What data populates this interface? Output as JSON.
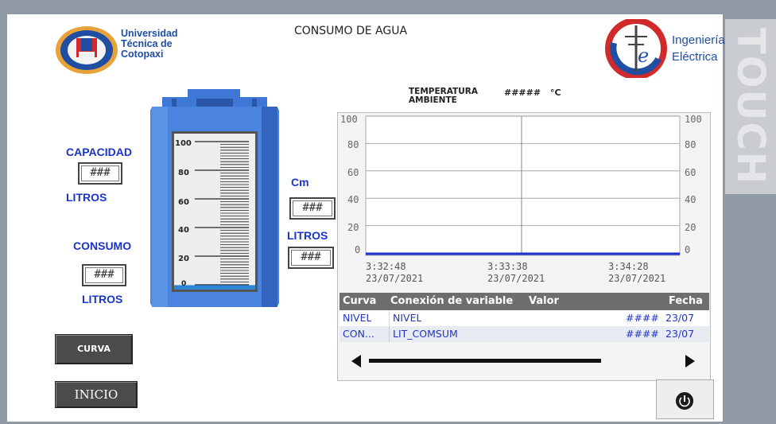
{
  "screen": {
    "title": "CONSUMO DE AGUA",
    "side_brand": "TOUCH"
  },
  "logos": {
    "university": {
      "name_lines": [
        "Universidad",
        "Técnica de",
        "Cotopaxi"
      ]
    },
    "engineering": {
      "name_lines": [
        "Ingeniería",
        "Eléctrica"
      ]
    }
  },
  "left_panel": {
    "capacidad_label": "CAPACIDAD",
    "capacidad_value": "###",
    "capacidad_unit": "LITROS",
    "consumo_label": "CONSUMO",
    "consumo_value": "###",
    "consumo_unit": "LITROS"
  },
  "tank": {
    "scale": [
      "100",
      "80",
      "60",
      "40",
      "20",
      "0"
    ],
    "level_percent": 2
  },
  "middle_panel": {
    "cm_label": "Cm",
    "cm_value": "###",
    "litros_label": "LITROS",
    "litros_value": "###"
  },
  "temperature": {
    "label_lines": [
      "TEMPERATURA",
      "AMBIENTE"
    ],
    "value": "#####",
    "unit": "°C"
  },
  "trend": {
    "y_ticks": [
      "100",
      "80",
      "60",
      "40",
      "20",
      "0"
    ],
    "x_ticks": [
      {
        "time": "3:32:48",
        "date": "23/07/2021"
      },
      {
        "time": "3:33:38",
        "date": "23/07/2021"
      },
      {
        "time": "3:34:28",
        "date": "23/07/2021"
      }
    ],
    "series_color": "#1f2fd0",
    "table": {
      "headers": [
        "Curva",
        "Conexión de variable",
        "Valor",
        "Fecha"
      ],
      "rows": [
        {
          "curve": "NIVEL",
          "variable": "NIVEL",
          "value": "####",
          "date": "23/07"
        },
        {
          "curve": "CON...",
          "variable": "LIT_COMSUM",
          "value": "####",
          "date": "23/07"
        }
      ]
    }
  },
  "buttons": {
    "curva": "CURVA",
    "inicio": "INICIO"
  },
  "colors": {
    "label_blue": "#1a33c8",
    "tank_blue": "#3f77d6",
    "button_gray": "#4b4b4b",
    "frame_gray": "#8f9aa6"
  }
}
